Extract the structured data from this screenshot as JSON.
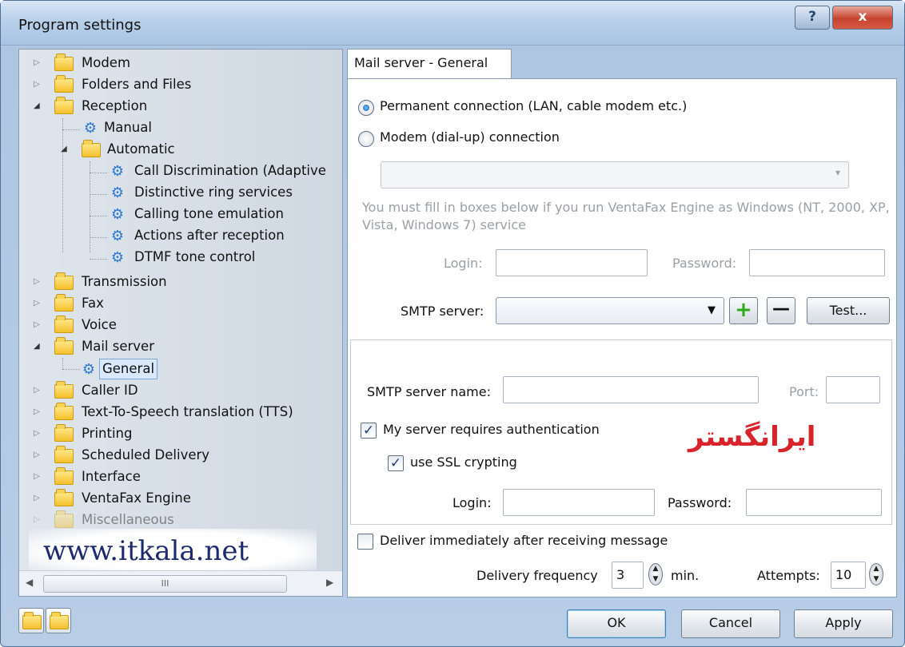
{
  "window": {
    "title": "Program settings",
    "help_label": "?",
    "close_label": "x"
  },
  "tree": {
    "items": [
      {
        "label": "Modem"
      },
      {
        "label": "Folders and Files"
      },
      {
        "label": "Reception"
      },
      {
        "label": "Manual"
      },
      {
        "label": "Automatic"
      },
      {
        "label": "Call Discrimination (Adaptive"
      },
      {
        "label": "Distinctive ring services"
      },
      {
        "label": "Calling tone emulation"
      },
      {
        "label": "Actions after reception"
      },
      {
        "label": "DTMF tone control"
      },
      {
        "label": "Transmission"
      },
      {
        "label": "Fax"
      },
      {
        "label": "Voice"
      },
      {
        "label": "Mail server"
      },
      {
        "label": "General"
      },
      {
        "label": "Caller ID"
      },
      {
        "label": "Text-To-Speech translation (TTS)"
      },
      {
        "label": "Printing"
      },
      {
        "label": "Scheduled Delivery"
      },
      {
        "label": "Interface"
      },
      {
        "label": "VentaFax Engine"
      },
      {
        "label": "Miscellaneous"
      }
    ],
    "scroll_thumb": "III"
  },
  "watermark": "www.itkala.net",
  "tab": {
    "label": "Mail server - General"
  },
  "connection": {
    "permanent_label": "Permanent connection (LAN, cable modem etc.)",
    "modem_label": "Modem (dial-up) connection",
    "selected": "permanent",
    "modem_select_value": ""
  },
  "service_note": "You must fill in boxes below if you run VentaFax Engine as Windows (NT, 2000, XP, Vista, Windows 7) service",
  "service_login": {
    "label": "Login:",
    "value": ""
  },
  "service_password": {
    "label": "Password:",
    "value": ""
  },
  "smtp": {
    "label": "SMTP server:",
    "value": "",
    "add_label": "+",
    "remove_label": "—",
    "test_label": "Test..."
  },
  "server": {
    "name_label": "SMTP server name:",
    "name_value": "",
    "port_label": "Port:",
    "port_value": "",
    "auth_label": "My server requires authentication",
    "auth_checked": true,
    "ssl_label": "use SSL crypting",
    "ssl_checked": true,
    "login_label": "Login:",
    "login_value": "",
    "password_label": "Password:",
    "password_value": ""
  },
  "logo_text": "ایرانگستر",
  "delivery": {
    "immediate_label": "Deliver immediately after receiving message",
    "immediate_checked": false,
    "frequency_label": "Delivery frequency",
    "frequency_value": "3",
    "frequency_unit": "min.",
    "attempts_label": "Attempts:",
    "attempts_value": "10"
  },
  "buttons": {
    "ok": "OK",
    "cancel": "Cancel",
    "apply": "Apply"
  },
  "colors": {
    "accent": "#2c77d4",
    "logo_red": "#d9232a",
    "add_green": "#2eaa1d"
  }
}
